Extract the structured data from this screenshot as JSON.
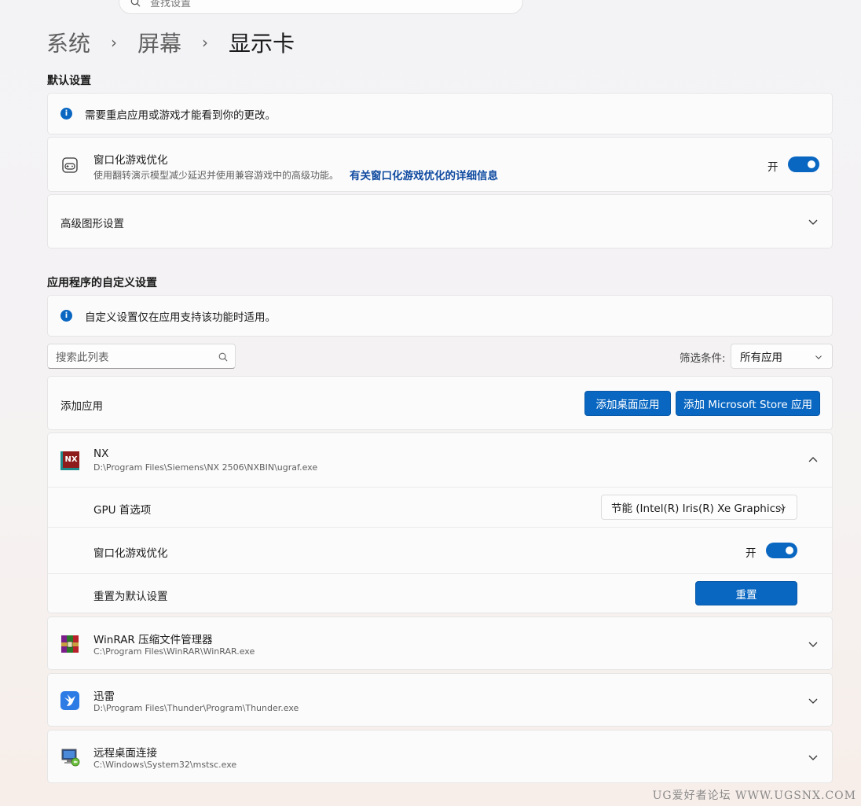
{
  "search": {
    "placeholder": "查找设置"
  },
  "breadcrumb": {
    "items": [
      "系统",
      "屏幕",
      "显示卡"
    ],
    "separator": "›"
  },
  "default_settings": {
    "title": "默认设置",
    "info": "需要重启应用或游戏才能看到你的更改。",
    "windowed_opt": {
      "title": "窗口化游戏优化",
      "desc": "使用翻转演示模型减少延迟并使用兼容游戏中的高级功能。",
      "link": "有关窗口化游戏优化的详细信息",
      "state_label": "开",
      "enabled": true
    },
    "advanced_graphics": "高级图形设置"
  },
  "app_custom": {
    "title": "应用程序的自定义设置",
    "info": "自定义设置仅在应用支持该功能时适用。",
    "list_search_placeholder": "搜索此列表",
    "filter_label": "筛选条件:",
    "filter_value": "所有应用",
    "add_app_label": "添加应用",
    "add_desktop_btn": "添加桌面应用",
    "add_store_btn": "添加 Microsoft Store 应用"
  },
  "apps": [
    {
      "name": "NX",
      "path": "D:\\Program Files\\Siemens\\NX 2506\\NXBIN\\ugraf.exe",
      "icon": "nx-icon",
      "icon_text": "NX",
      "expanded": true,
      "gpu_label": "GPU 首选项",
      "gpu_value": "节能 (Intel(R) Iris(R) Xe Graphics)",
      "windowed_label": "窗口化游戏优化",
      "windowed_state": "开",
      "reset_label": "重置为默认设置",
      "reset_btn": "重置"
    },
    {
      "name": "WinRAR 压缩文件管理器",
      "path": "C:\\Program Files\\WinRAR\\WinRAR.exe",
      "icon": "winrar-icon",
      "expanded": false
    },
    {
      "name": "迅雷",
      "path": "D:\\Program Files\\Thunder\\Program\\Thunder.exe",
      "icon": "thunder-icon",
      "expanded": false
    },
    {
      "name": "远程桌面连接",
      "path": "C:\\Windows\\System32\\mstsc.exe",
      "icon": "remote-desktop-icon",
      "expanded": false
    }
  ],
  "watermark": "UG爱好者论坛 WWW.UGSNX.COM",
  "colors": {
    "accent": "#0a67c1",
    "link": "#0f4aa0"
  }
}
